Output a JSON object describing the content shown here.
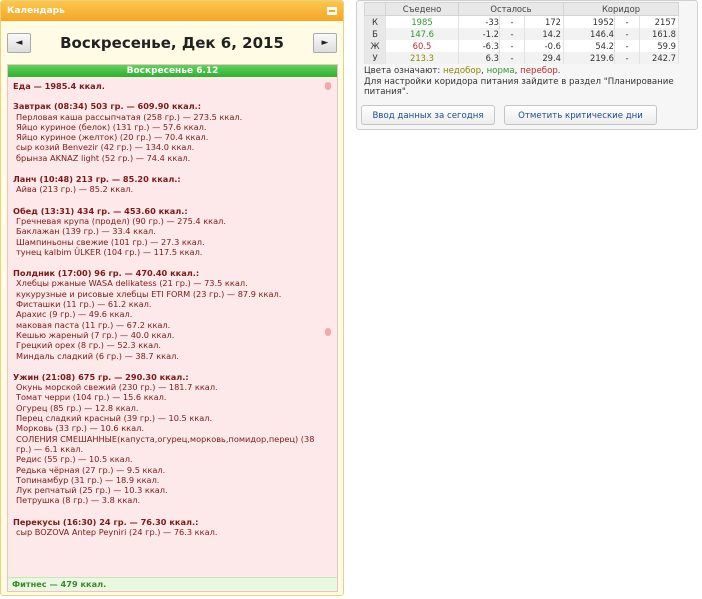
{
  "calendar": {
    "header": "Календарь",
    "prev_label": "◄",
    "next_label": "►",
    "date_title": "Воскресенье, Дек 6, 2015",
    "day_title": "Воскресенье 6.12",
    "total": "Еда — 1985.4 ккал.",
    "meals": [
      {
        "header": "Завтрак (08:34) 503 гр. — 609.90 ккал.:",
        "items": [
          "Перловая каша рассыпчатая (258 гр.) — 273.5 ккал.",
          "Яйцо куриное (белок) (131 гр.) — 57.6 ккал.",
          "Яйцо куриное (желток) (20 гр.) — 70.4 ккал.",
          "сыр козий Benvezir (42 гр.) — 134.0 ккал.",
          "брынза AKNAZ light (52 гр.) — 74.4 ккал."
        ]
      },
      {
        "header": "Ланч (10:48) 213 гр. — 85.20 ккал.:",
        "items": [
          "Айва (213 гр.) — 85.2 ккал."
        ]
      },
      {
        "header": "Обед (13:31) 434 гр. — 453.60 ккал.:",
        "items": [
          "Гречневая крупа (продел) (90 гр.) — 275.4 ккал.",
          "Баклажан (139 гр.) — 33.4 ккал.",
          "Шампиньоны свежие (101 гр.) — 27.3 ккал.",
          "тунец kalbim ÜLKER (104 гр.) — 117.5 ккал."
        ]
      },
      {
        "header": "Полдник (17:00) 96 гр. — 470.40 ккал.:",
        "items": [
          "Хлебцы ржаные WASA delikatess (21 гр.) — 73.5 ккал.",
          "кукурузные и рисовые хлебцы ETI FORM (23 гр.) — 87.9 ккал.",
          "Фисташки (11 гр.) — 61.2 ккал.",
          "Арахис (9 гр.) — 49.6 ккал.",
          "маковая паста (11 гр.) — 67.2 ккал.",
          "Кешью жареный (7 гр.) — 40.0 ккал.",
          "Грецкий орех (8 гр.) — 52.3 ккал.",
          "Миндаль сладкий (6 гр.) — 38.7 ккал."
        ]
      },
      {
        "header": "Ужин (21:08) 675 гр. — 290.30 ккал.:",
        "items": [
          "Окунь морской свежий (230 гр.) — 181.7 ккал.",
          "Томат черри (104 гр.) — 15.6 ккал.",
          "Огурец (85 гр.) — 12.8 ккал.",
          "Перец сладкий красный (39 гр.) — 10.5 ккал.",
          "Морковь (33 гр.) — 10.6 ккал.",
          "СОЛЕНИЯ СМЕШАННЫЕ(капуста,огурец,морковь,помидор,перец) (38 гр.) — 6.1 ккал.",
          "Редис (55 гр.) — 10.5 ккал.",
          "Редька чёрная (27 гр.) — 9.5 ккал.",
          "Топинамбур (31 гр.) — 18.9 ккал.",
          "Лук репчатый (25 гр.) — 10.3 ккал.",
          "Петрушка (8 гр.) — 3.8 ккал."
        ]
      },
      {
        "header": "Перекусы (16:30) 24 гр. — 76.30 ккал.:",
        "items": [
          "сыр BOZOVA Antep Peyniri (24 гр.) — 76.3 ккал."
        ]
      }
    ],
    "fitness": "Фитнес — 479 ккал."
  },
  "summary": {
    "headers": [
      "Съедено",
      "Осталось",
      "Коридор"
    ],
    "rows": [
      {
        "label": "К",
        "eaten": "1985",
        "eaten_color": "#2e9a2e",
        "rem_from": "-33",
        "rem_to": "172",
        "cor_from": "1952",
        "cor_to": "2157"
      },
      {
        "label": "Б",
        "eaten": "147.6",
        "eaten_color": "#2e9a2e",
        "rem_from": "-1.2",
        "rem_to": "14.2",
        "cor_from": "146.4",
        "cor_to": "161.8"
      },
      {
        "label": "Ж",
        "eaten": "60.5",
        "eaten_color": "#c0262e",
        "rem_from": "-6.3",
        "rem_to": "-0.6",
        "cor_from": "54.2",
        "cor_to": "59.9"
      },
      {
        "label": "У",
        "eaten": "213.3",
        "eaten_color": "#8a8a00",
        "rem_from": "6.3",
        "rem_to": "29.4",
        "cor_from": "219.6",
        "cor_to": "242.7"
      }
    ],
    "dash": "-",
    "legend_prefix": "Цвета означают:",
    "legend_under": "недобор",
    "legend_comma1": ",",
    "legend_norm": "норма",
    "legend_comma2": ",",
    "legend_over": "перебор",
    "legend_end": ".",
    "legend_line2": "Для настройки коридора питания зайдите в раздел \"Планирование питания\".",
    "btn_today": "Ввод данных за сегодня",
    "btn_critical": "Отметить критические дни"
  },
  "colors": {
    "header": "#f5a623",
    "day_bg": "#fde9e9",
    "green": "#2fae2f"
  }
}
